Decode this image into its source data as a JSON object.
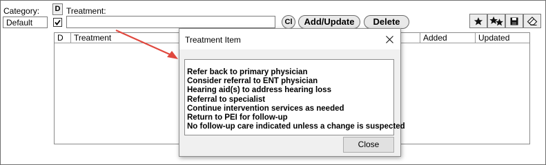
{
  "form": {
    "category_label": "Category:",
    "category_value": "Default",
    "d_label": "D",
    "d_checked": true,
    "treatment_label": "Treatment:",
    "treatment_value": "",
    "cl_label": "Cl",
    "add_update_label": "Add/Update",
    "delete_label": "Delete"
  },
  "toolbar": {
    "icons": [
      "star-icon",
      "multi-star-icon",
      "save-disk-icon",
      "eraser-icon"
    ]
  },
  "grid": {
    "columns": [
      "D",
      "Treatment",
      "Added",
      "Updated"
    ]
  },
  "dialog": {
    "title": "Treatment Item",
    "items": [
      "Refer back to primary physician",
      "Consider referral to ENT physician",
      "Hearing aid(s) to address hearing loss",
      "Referral to specialist",
      "Continue intervention services as needed",
      "Return to PEI for follow-up",
      "No follow-up care indicated unless a change is suspected"
    ],
    "close_label": "Close"
  },
  "colors": {
    "arrow": "#e0483e",
    "button_face": "#e9e9e9"
  }
}
